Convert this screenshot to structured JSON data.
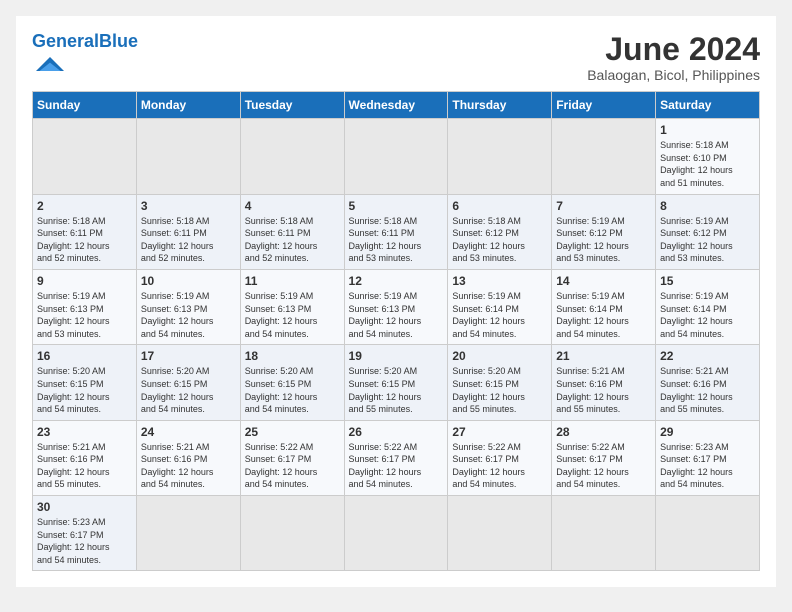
{
  "header": {
    "logo_general": "General",
    "logo_blue": "Blue",
    "month_title": "June 2024",
    "location": "Balaogan, Bicol, Philippines"
  },
  "weekdays": [
    "Sunday",
    "Monday",
    "Tuesday",
    "Wednesday",
    "Thursday",
    "Friday",
    "Saturday"
  ],
  "weeks": [
    [
      {
        "day": "",
        "info": ""
      },
      {
        "day": "",
        "info": ""
      },
      {
        "day": "",
        "info": ""
      },
      {
        "day": "",
        "info": ""
      },
      {
        "day": "",
        "info": ""
      },
      {
        "day": "",
        "info": ""
      },
      {
        "day": "1",
        "info": "Sunrise: 5:18 AM\nSunset: 6:10 PM\nDaylight: 12 hours\nand 51 minutes."
      }
    ],
    [
      {
        "day": "2",
        "info": "Sunrise: 5:18 AM\nSunset: 6:11 PM\nDaylight: 12 hours\nand 52 minutes."
      },
      {
        "day": "3",
        "info": "Sunrise: 5:18 AM\nSunset: 6:11 PM\nDaylight: 12 hours\nand 52 minutes."
      },
      {
        "day": "4",
        "info": "Sunrise: 5:18 AM\nSunset: 6:11 PM\nDaylight: 12 hours\nand 52 minutes."
      },
      {
        "day": "5",
        "info": "Sunrise: 5:18 AM\nSunset: 6:11 PM\nDaylight: 12 hours\nand 53 minutes."
      },
      {
        "day": "6",
        "info": "Sunrise: 5:18 AM\nSunset: 6:12 PM\nDaylight: 12 hours\nand 53 minutes."
      },
      {
        "day": "7",
        "info": "Sunrise: 5:19 AM\nSunset: 6:12 PM\nDaylight: 12 hours\nand 53 minutes."
      },
      {
        "day": "8",
        "info": "Sunrise: 5:19 AM\nSunset: 6:12 PM\nDaylight: 12 hours\nand 53 minutes."
      }
    ],
    [
      {
        "day": "9",
        "info": "Sunrise: 5:19 AM\nSunset: 6:13 PM\nDaylight: 12 hours\nand 53 minutes."
      },
      {
        "day": "10",
        "info": "Sunrise: 5:19 AM\nSunset: 6:13 PM\nDaylight: 12 hours\nand 54 minutes."
      },
      {
        "day": "11",
        "info": "Sunrise: 5:19 AM\nSunset: 6:13 PM\nDaylight: 12 hours\nand 54 minutes."
      },
      {
        "day": "12",
        "info": "Sunrise: 5:19 AM\nSunset: 6:13 PM\nDaylight: 12 hours\nand 54 minutes."
      },
      {
        "day": "13",
        "info": "Sunrise: 5:19 AM\nSunset: 6:14 PM\nDaylight: 12 hours\nand 54 minutes."
      },
      {
        "day": "14",
        "info": "Sunrise: 5:19 AM\nSunset: 6:14 PM\nDaylight: 12 hours\nand 54 minutes."
      },
      {
        "day": "15",
        "info": "Sunrise: 5:19 AM\nSunset: 6:14 PM\nDaylight: 12 hours\nand 54 minutes."
      }
    ],
    [
      {
        "day": "16",
        "info": "Sunrise: 5:20 AM\nSunset: 6:15 PM\nDaylight: 12 hours\nand 54 minutes."
      },
      {
        "day": "17",
        "info": "Sunrise: 5:20 AM\nSunset: 6:15 PM\nDaylight: 12 hours\nand 54 minutes."
      },
      {
        "day": "18",
        "info": "Sunrise: 5:20 AM\nSunset: 6:15 PM\nDaylight: 12 hours\nand 54 minutes."
      },
      {
        "day": "19",
        "info": "Sunrise: 5:20 AM\nSunset: 6:15 PM\nDaylight: 12 hours\nand 55 minutes."
      },
      {
        "day": "20",
        "info": "Sunrise: 5:20 AM\nSunset: 6:15 PM\nDaylight: 12 hours\nand 55 minutes."
      },
      {
        "day": "21",
        "info": "Sunrise: 5:21 AM\nSunset: 6:16 PM\nDaylight: 12 hours\nand 55 minutes."
      },
      {
        "day": "22",
        "info": "Sunrise: 5:21 AM\nSunset: 6:16 PM\nDaylight: 12 hours\nand 55 minutes."
      }
    ],
    [
      {
        "day": "23",
        "info": "Sunrise: 5:21 AM\nSunset: 6:16 PM\nDaylight: 12 hours\nand 55 minutes."
      },
      {
        "day": "24",
        "info": "Sunrise: 5:21 AM\nSunset: 6:16 PM\nDaylight: 12 hours\nand 54 minutes."
      },
      {
        "day": "25",
        "info": "Sunrise: 5:22 AM\nSunset: 6:17 PM\nDaylight: 12 hours\nand 54 minutes."
      },
      {
        "day": "26",
        "info": "Sunrise: 5:22 AM\nSunset: 6:17 PM\nDaylight: 12 hours\nand 54 minutes."
      },
      {
        "day": "27",
        "info": "Sunrise: 5:22 AM\nSunset: 6:17 PM\nDaylight: 12 hours\nand 54 minutes."
      },
      {
        "day": "28",
        "info": "Sunrise: 5:22 AM\nSunset: 6:17 PM\nDaylight: 12 hours\nand 54 minutes."
      },
      {
        "day": "29",
        "info": "Sunrise: 5:23 AM\nSunset: 6:17 PM\nDaylight: 12 hours\nand 54 minutes."
      }
    ],
    [
      {
        "day": "30",
        "info": "Sunrise: 5:23 AM\nSunset: 6:17 PM\nDaylight: 12 hours\nand 54 minutes."
      },
      {
        "day": "",
        "info": ""
      },
      {
        "day": "",
        "info": ""
      },
      {
        "day": "",
        "info": ""
      },
      {
        "day": "",
        "info": ""
      },
      {
        "day": "",
        "info": ""
      },
      {
        "day": "",
        "info": ""
      }
    ]
  ]
}
